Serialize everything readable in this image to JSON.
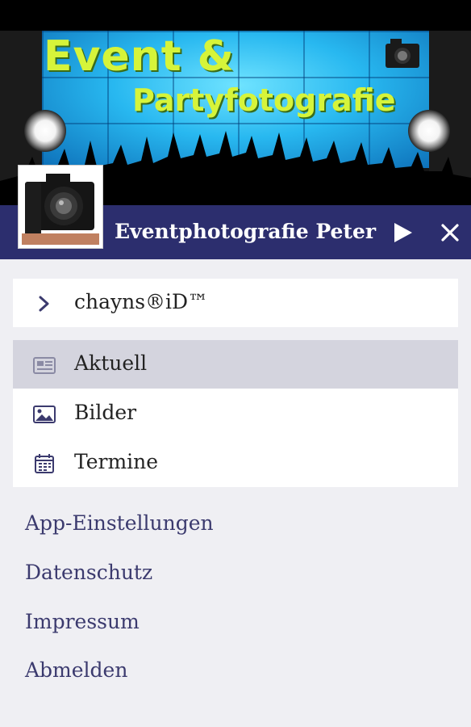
{
  "colors": {
    "header_bg": "#2c2e6e",
    "menu_bg": "#efeff3",
    "active_row": "#d4d4de",
    "link_text": "#3b3a6e",
    "banner_text": "#d6f43a"
  },
  "banner": {
    "line1": "Event &",
    "line2": "Partyfotografie"
  },
  "header": {
    "site_title": "Eventphotografie Peter",
    "play_icon": "play-icon",
    "close_icon": "close-icon"
  },
  "login": {
    "label": "chayns®iD™",
    "icon": "chevron-right-icon"
  },
  "menu": {
    "items": [
      {
        "label": "Aktuell",
        "icon": "newspaper-icon",
        "active": true
      },
      {
        "label": "Bilder",
        "icon": "image-icon",
        "active": false
      },
      {
        "label": "Termine",
        "icon": "calendar-icon",
        "active": false
      }
    ]
  },
  "links": {
    "app_settings": "App-Einstellungen",
    "privacy": "Datenschutz",
    "imprint": "Impressum",
    "logout": "Abmelden"
  }
}
